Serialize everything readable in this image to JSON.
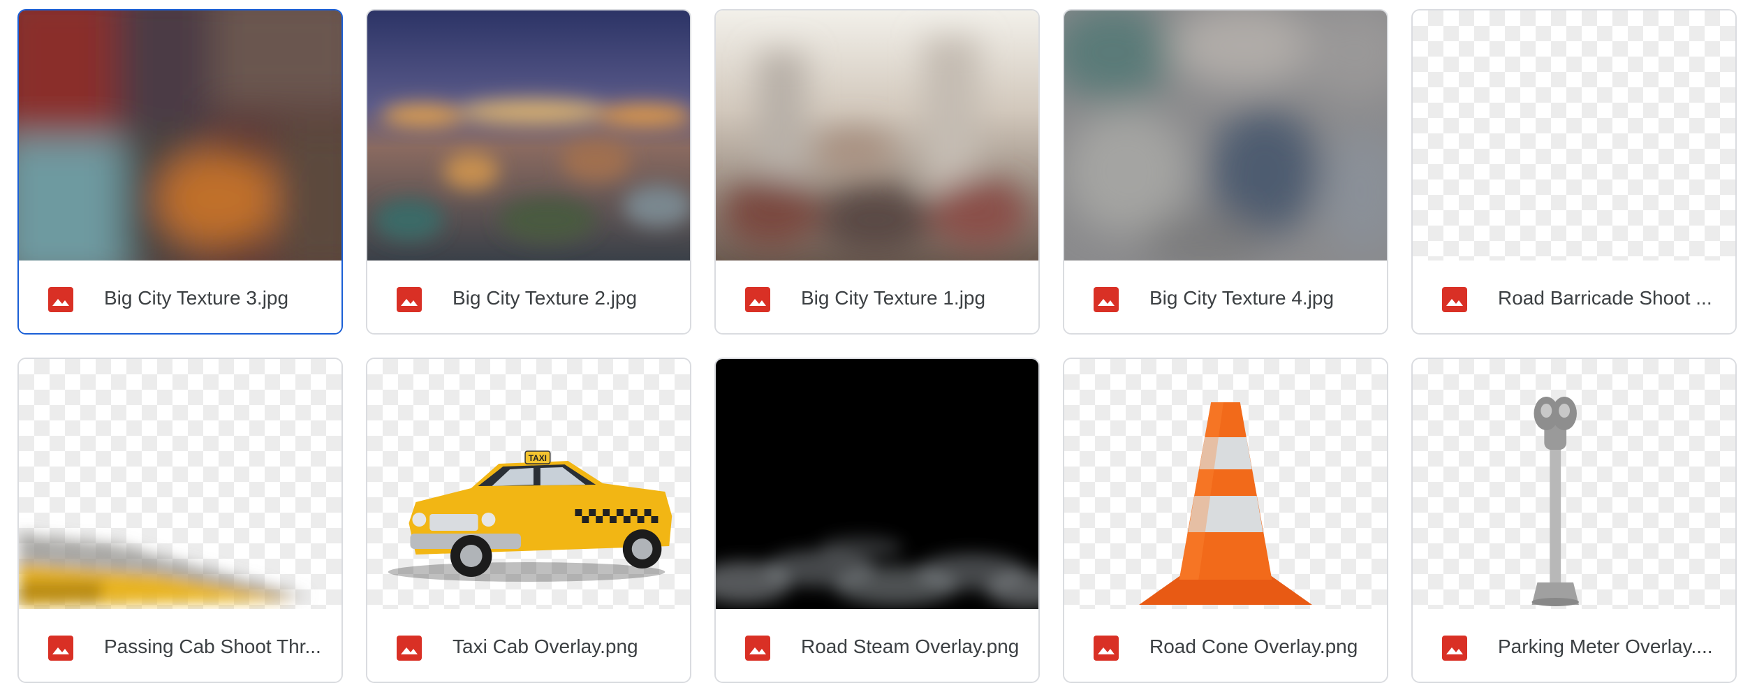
{
  "files": [
    {
      "name": "Big City Texture 3.jpg",
      "type_icon": "image-file-icon",
      "selected": true
    },
    {
      "name": "Big City Texture 2.jpg",
      "type_icon": "image-file-icon"
    },
    {
      "name": "Big City Texture 1.jpg",
      "type_icon": "image-file-icon"
    },
    {
      "name": "Big City Texture 4.jpg",
      "type_icon": "image-file-icon"
    },
    {
      "name": "Road Barricade Shoot ...",
      "type_icon": "image-file-icon"
    },
    {
      "name": "Passing Cab Shoot Thr...",
      "type_icon": "image-file-icon"
    },
    {
      "name": "Taxi Cab Overlay.png",
      "type_icon": "image-file-icon"
    },
    {
      "name": "Road Steam Overlay.png",
      "type_icon": "image-file-icon"
    },
    {
      "name": "Road Cone Overlay.png",
      "type_icon": "image-file-icon"
    },
    {
      "name": "Parking Meter Overlay....",
      "type_icon": "image-file-icon"
    }
  ],
  "taxi_sign": "TAXI",
  "colors": {
    "selected_border": "#1a5fd6",
    "image_icon": "#d93025",
    "card_border": "#dadce0",
    "file_name_text": "#3c4043"
  }
}
